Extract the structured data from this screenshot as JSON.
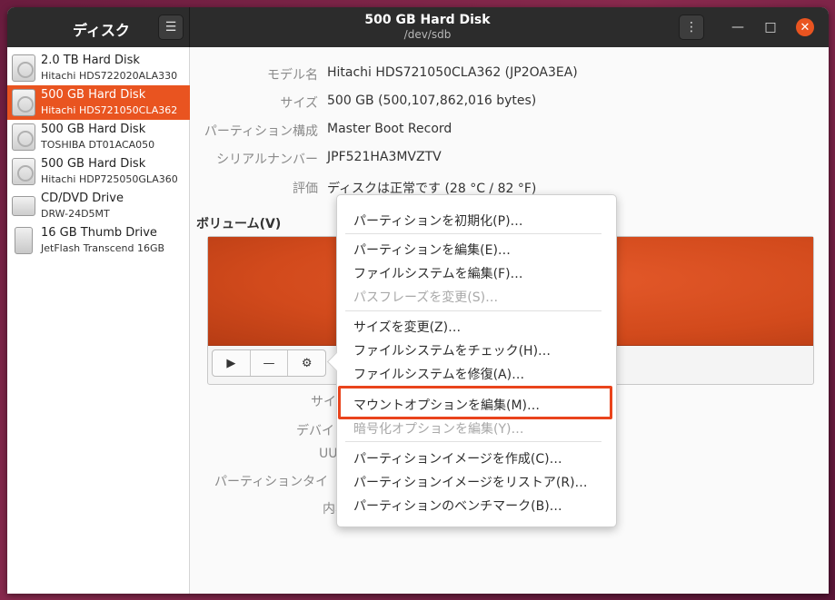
{
  "header": {
    "sidebar_title": "ディスク",
    "title": "500 GB Hard Disk",
    "subtitle": "/dev/sdb",
    "menu_glyph": "☰",
    "kebab_glyph": "⋮",
    "minimize_glyph": "—",
    "maximize_glyph": "□",
    "close_glyph": "✕"
  },
  "sidebar": {
    "items": [
      {
        "name": "2.0 TB Hard Disk",
        "model": "Hitachi HDS722020ALA330",
        "icon": "hard-disk-icon"
      },
      {
        "name": "500 GB Hard Disk",
        "model": "Hitachi HDS721050CLA362",
        "icon": "hard-disk-icon"
      },
      {
        "name": "500 GB Hard Disk",
        "model": "TOSHIBA DT01ACA050",
        "icon": "hard-disk-icon"
      },
      {
        "name": "500 GB Hard Disk",
        "model": "Hitachi HDP725050GLA360",
        "icon": "hard-disk-icon"
      },
      {
        "name": "CD/DVD Drive",
        "model": "DRW-24D5MT",
        "icon": "optical-drive-icon"
      },
      {
        "name": "16 GB Thumb Drive",
        "model": "JetFlash Transcend 16GB",
        "icon": "usb-drive-icon"
      }
    ]
  },
  "info": {
    "model_label": "モデル名",
    "model_value": "Hitachi HDS721050CLA362 (JP2OA3EA)",
    "size_label": "サイズ",
    "size_value": "500 GB (500,107,862,016 bytes)",
    "partition_label": "パーティション構成",
    "partition_value": "Master Boot Record",
    "serial_label": "シリアルナンバー",
    "serial_value": "JPF521HA3MVZTV",
    "assessment_label": "評価",
    "assessment_value": "ディスクは正常です (28 °C / 82 °F)"
  },
  "volumes": {
    "title": "ボリューム(V)",
    "play_glyph": "▶",
    "minus_glyph": "—",
    "gear_glyph": "⚙",
    "lower_labels": {
      "size": "サイ",
      "device": "デバイ",
      "uuid": "UUID",
      "partition_type": "パーティションタイ",
      "contents": "内容"
    }
  },
  "menu": {
    "format": "パーティションを初期化(P)…",
    "edit_partition": "パーティションを編集(E)…",
    "edit_filesystem": "ファイルシステムを編集(F)…",
    "change_passphrase": "パスフレーズを変更(S)…",
    "resize": "サイズを変更(Z)…",
    "check_fs": "ファイルシステムをチェック(H)…",
    "repair_fs": "ファイルシステムを修復(A)…",
    "edit_mount": "マウントオプションを編集(M)…",
    "edit_encryption": "暗号化オプションを編集(Y)…",
    "create_image": "パーティションイメージを作成(C)…",
    "restore_image": "パーティションイメージをリストア(R)…",
    "benchmark": "パーティションのベンチマーク(B)…"
  }
}
